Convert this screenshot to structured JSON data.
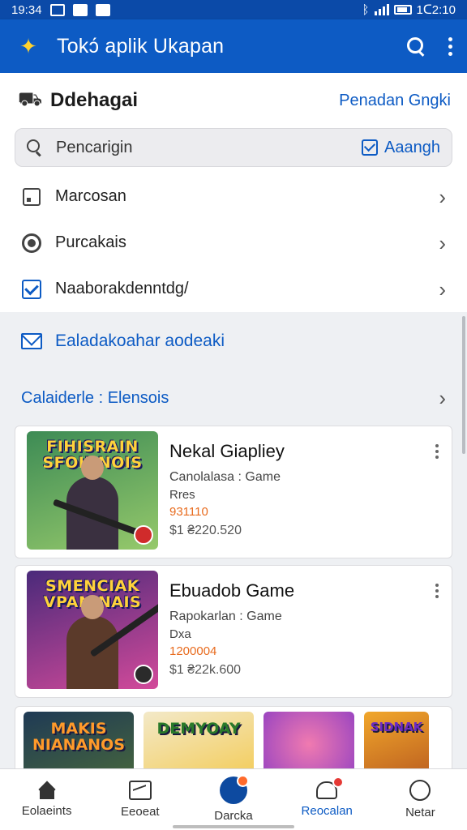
{
  "status_bar": {
    "time": "19:34",
    "clock_right": "1ᑕ2:10"
  },
  "app_bar": {
    "title": "Tokɔ́ aplik Ukapan"
  },
  "header": {
    "title": "Ddehagai",
    "link": "Penadan Gngki"
  },
  "search": {
    "placeholder": "Pencarigin",
    "filter_label": "Aaangh"
  },
  "menu": [
    {
      "label": "Marcosan",
      "icon": "square-icon"
    },
    {
      "label": "Purcakais",
      "icon": "camera-icon"
    },
    {
      "label": "Naaborakdenntdg/",
      "icon": "checkbox-icon"
    }
  ],
  "mail": {
    "label": "Ealadakoahar aodeaki"
  },
  "category": {
    "label": "Calaiderle : Elensois"
  },
  "games": [
    {
      "title": "Nekal Giapliey",
      "subtitle": "Canolalasa : Game",
      "line": "Rres",
      "code": "931110",
      "price": "$1  ₴220.520",
      "banner": "FIHISRAIN SFOINNOIS",
      "colors": {
        "bg1": "#3d8b55",
        "bg2": "#96c96b",
        "banner": "#ffd23b"
      }
    },
    {
      "title": "Ebuadob Game",
      "subtitle": "Rapokarlan : Game",
      "line": "Dxa",
      "code": "1200004",
      "price": "$1  ₴22k.600",
      "banner": "SMENCIAK VPANINAIS",
      "colors": {
        "bg1": "#4a2a7a",
        "bg2": "#d24a9a",
        "banner": "#ffe04a"
      }
    }
  ],
  "strip": [
    {
      "text": "MAKIS NIANANOS",
      "bg": "#1f3a55"
    },
    {
      "text": "DEMYOAY",
      "bg": "#f3e9c8"
    },
    {
      "text": "",
      "bg": "#8a3bc4"
    },
    {
      "text": "SIDNAK",
      "bg": "#f1a72b"
    }
  ],
  "bottom_nav": [
    {
      "label": "Eolaeints",
      "icon": "home-icon",
      "active": false
    },
    {
      "label": "Eeoeat",
      "icon": "chart-icon",
      "active": false
    },
    {
      "label": "Darcka",
      "icon": "dashboard-icon",
      "active": false
    },
    {
      "label": "Reocalan",
      "icon": "bell-icon",
      "active": true
    },
    {
      "label": "Netar",
      "icon": "face-icon",
      "active": false
    }
  ],
  "colors": {
    "primary": "#0d5bc4",
    "status_bar": "#0b4aa8",
    "accent_orange": "#e86b1e"
  }
}
